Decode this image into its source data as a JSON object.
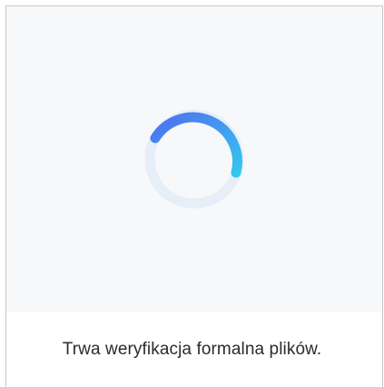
{
  "status": {
    "message": "Trwa weryfikacja formalna plików."
  },
  "spinner": {
    "icon": "loading-spinner-icon",
    "colors": {
      "primary": "#4f6ff0",
      "secondary": "#34c6f0",
      "track": "#e6eef8"
    }
  }
}
